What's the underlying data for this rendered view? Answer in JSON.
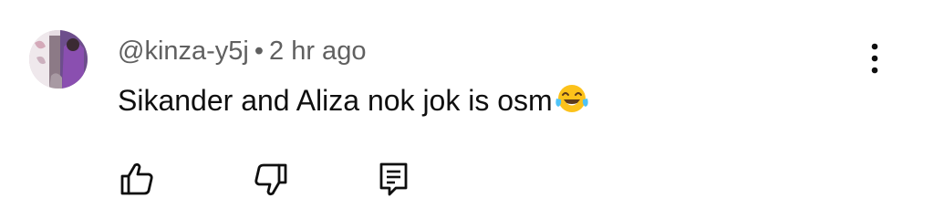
{
  "comment": {
    "author": "@kinza-y5j",
    "separator": "•",
    "time": "2 hr ago",
    "text": "Sikander and Aliza nok jok is osm",
    "emoji": "face-with-tears-of-joy",
    "avatar": "user-avatar-image"
  },
  "icons": {
    "more": "more-vertical-icon",
    "like": "thumbs-up-icon",
    "dislike": "thumbs-down-icon",
    "reply": "reply-comment-icon"
  },
  "colors": {
    "meta_text": "#606060",
    "body_text": "#0f0f0f",
    "icon": "#0f0f0f",
    "emoji_face": "#fcc21b",
    "emoji_tears": "#4fc3f7"
  }
}
